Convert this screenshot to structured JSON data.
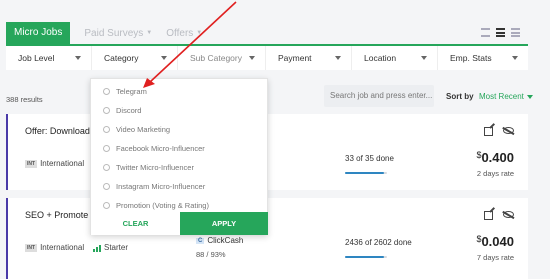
{
  "tabs": {
    "active": "Micro Jobs",
    "items": [
      {
        "label": "Paid Surveys"
      },
      {
        "label": "Offers"
      }
    ]
  },
  "filters": {
    "job_level": "Job Level",
    "category": "Category",
    "sub_category": "Sub Category",
    "payment": "Payment",
    "location": "Location",
    "emp_stats": "Emp. Stats"
  },
  "results_count": "388 results",
  "search": {
    "placeholder": "Search job and press enter..."
  },
  "sort": {
    "label": "Sort by",
    "value": "Most Recent"
  },
  "category_dropdown": {
    "options": [
      "Telegram",
      "Discord",
      "Video Marketing",
      "Facebook Micro-Influencer",
      "Twitter Micro-Influencer",
      "Instagram Micro-Influencer",
      "Promotion (Voting & Rating)"
    ],
    "clear_label": "CLEAR",
    "apply_label": "APPLY"
  },
  "jobs": [
    {
      "title": "Offer: Download E",
      "country_badge": "INT",
      "country": "International",
      "done": "33 of 35 done",
      "progress": 0.94,
      "currency": "$",
      "price": "0.400",
      "rate": "2 days rate"
    },
    {
      "title": "SEO + Promote Co",
      "country_badge": "INT",
      "country": "International",
      "level": "Starter",
      "category_badge": "C",
      "category": "ClickCash",
      "success": "88 / 93%",
      "done": "2436 of 2602 done",
      "progress": 0.94,
      "currency": "$",
      "price": "0.040",
      "rate": "7 days rate"
    }
  ],
  "colors": {
    "accent": "#26a65b",
    "card_border": "#4a3aa8",
    "progress": "#2e86c1",
    "annotation_arrow": "#e02020"
  }
}
